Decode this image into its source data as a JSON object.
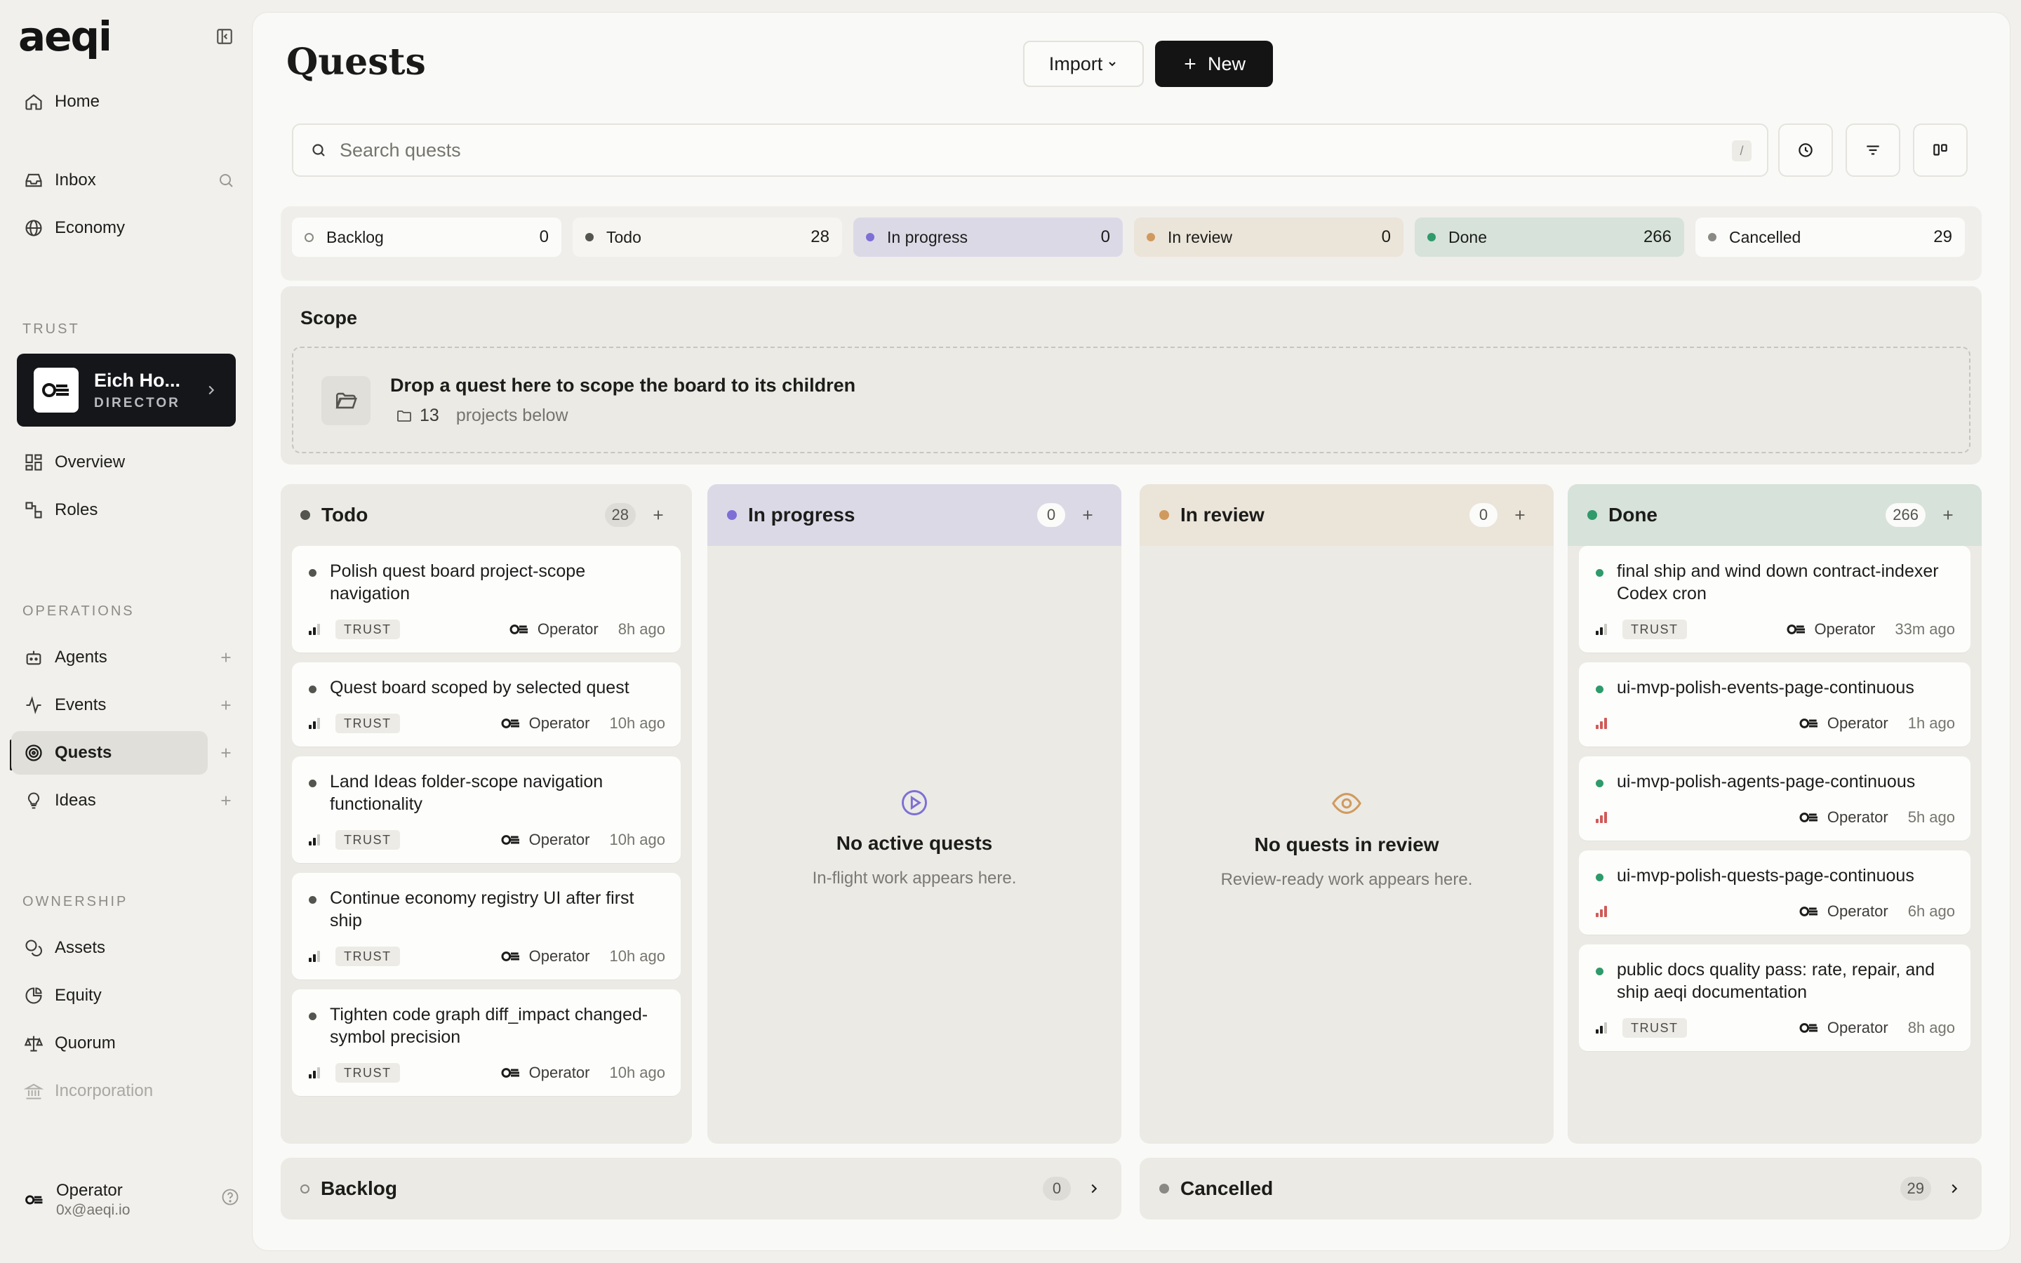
{
  "app": {
    "logo": "aeqi"
  },
  "sidebar": {
    "home": "Home",
    "inbox": "Inbox",
    "economy": "Economy",
    "trust_label": "TRUST",
    "trust": {
      "name": "Eich Ho...",
      "role": "DIRECTOR"
    },
    "overview": "Overview",
    "roles": "Roles",
    "operations_label": "OPERATIONS",
    "agents": "Agents",
    "events": "Events",
    "quests": "Quests",
    "ideas": "Ideas",
    "ownership_label": "OWNERSHIP",
    "assets": "Assets",
    "equity": "Equity",
    "quorum": "Quorum",
    "incorporation": "Incorporation",
    "user": {
      "name": "Operator",
      "email": "0x@aeqi.io"
    }
  },
  "header": {
    "title": "Quests",
    "import_label": "Import",
    "new_label": "New"
  },
  "search": {
    "placeholder": "Search quests",
    "shortcut": "/"
  },
  "statuses": [
    {
      "label": "Backlog",
      "count": "0"
    },
    {
      "label": "Todo",
      "count": "28"
    },
    {
      "label": "In progress",
      "count": "0"
    },
    {
      "label": "In review",
      "count": "0"
    },
    {
      "label": "Done",
      "count": "266"
    },
    {
      "label": "Cancelled",
      "count": "29"
    }
  ],
  "scope": {
    "title": "Scope",
    "drop_text": "Drop a quest here to scope the board to its children",
    "project_count": "13",
    "projects_text": "projects below"
  },
  "columns": {
    "todo": {
      "title": "Todo",
      "count": "28",
      "cards": [
        {
          "title": "Polish quest board project-scope navigation",
          "tag": "TRUST",
          "owner": "Operator",
          "time": "8h ago"
        },
        {
          "title": "Quest board scoped by selected quest",
          "tag": "TRUST",
          "owner": "Operator",
          "time": "10h ago"
        },
        {
          "title": "Land Ideas folder-scope navigation functionality",
          "tag": "TRUST",
          "owner": "Operator",
          "time": "10h ago"
        },
        {
          "title": "Continue economy registry UI after first ship",
          "tag": "TRUST",
          "owner": "Operator",
          "time": "10h ago"
        },
        {
          "title": "Tighten code graph diff_impact changed-symbol precision",
          "tag": "TRUST",
          "owner": "Operator",
          "time": "10h ago"
        }
      ]
    },
    "in_progress": {
      "title": "In progress",
      "count": "0",
      "empty_title": "No active quests",
      "empty_sub": "In-flight work appears here."
    },
    "in_review": {
      "title": "In review",
      "count": "0",
      "empty_title": "No quests in review",
      "empty_sub": "Review-ready work appears here."
    },
    "done": {
      "title": "Done",
      "count": "266",
      "cards": [
        {
          "title": "final ship and wind down contract-indexer Codex cron",
          "tag": "TRUST",
          "owner": "Operator",
          "time": "33m ago"
        },
        {
          "title": "ui-mvp-polish-events-page-continuous",
          "tag": "",
          "owner": "Operator",
          "time": "1h ago"
        },
        {
          "title": "ui-mvp-polish-agents-page-continuous",
          "tag": "",
          "owner": "Operator",
          "time": "5h ago"
        },
        {
          "title": "ui-mvp-polish-quests-page-continuous",
          "tag": "",
          "owner": "Operator",
          "time": "6h ago"
        },
        {
          "title": "public docs quality pass: rate, repair, and ship aeqi documentation",
          "tag": "TRUST",
          "owner": "Operator",
          "time": "8h ago"
        }
      ]
    }
  },
  "backlog": {
    "title": "Backlog",
    "count": "0"
  },
  "cancelled": {
    "title": "Cancelled",
    "count": "29"
  },
  "colors": {
    "todo": "#555550",
    "in_progress": "#7d6fd6",
    "in_review": "#d09a5e",
    "done": "#2f9a6a",
    "priority_red": "#d05a5a"
  }
}
